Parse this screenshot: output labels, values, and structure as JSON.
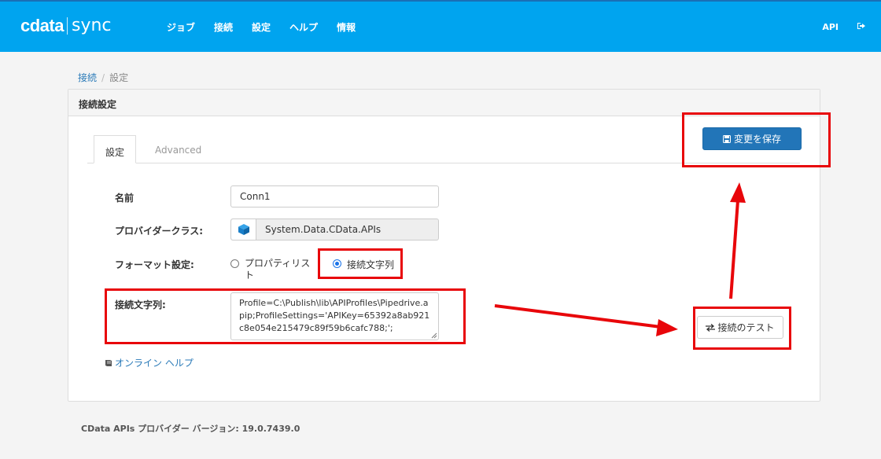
{
  "brand": {
    "part1": "cdata",
    "part2": "sync"
  },
  "nav": {
    "items": [
      "ジョブ",
      "接続",
      "設定",
      "ヘルプ",
      "情報"
    ],
    "right": {
      "api": "API",
      "logout_icon": "logout-icon"
    }
  },
  "breadcrumb": {
    "parent": "接続",
    "separator": "/",
    "current": "設定"
  },
  "panel": {
    "title": "接続設定",
    "tabs": [
      {
        "label": "設定",
        "active": true
      },
      {
        "label": "Advanced",
        "active": false
      }
    ],
    "save_button": "変更を保存",
    "fields": {
      "name": {
        "label": "名前",
        "value": "Conn1"
      },
      "provider": {
        "label": "プロバイダークラス:",
        "value": "System.Data.CData.APIs",
        "icon": "cube-icon"
      },
      "format": {
        "label": "フォーマット設定:",
        "options": [
          {
            "label": "プロパティリスト",
            "checked": false
          },
          {
            "label": "接続文字列",
            "checked": true
          }
        ]
      },
      "connection_string": {
        "label": "接続文字列:",
        "value": "Profile=C:\\Publish\\lib\\APIProfiles\\Pipedrive.apip;ProfileSettings='APIKey=65392a8ab921c8e054e215479c89f59b6cafc788;';"
      }
    },
    "help_link": "オンライン ヘルプ"
  },
  "test_button": "接続のテスト",
  "footer": "CData APIs プロバイダー バージョン: 19.0.7439.0",
  "colors": {
    "topbar": "#00a4ef",
    "primary_button": "#2275b8",
    "annotation_red": "#e8060a",
    "link": "#2a7ab8"
  }
}
